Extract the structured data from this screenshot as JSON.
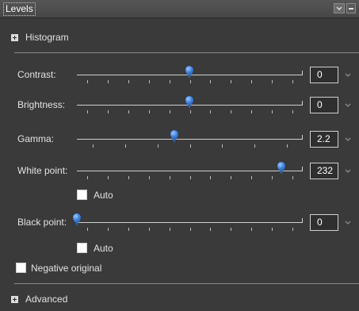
{
  "panel": {
    "title": "Levels",
    "dropdown_icon": "chevron-down-icon",
    "collapse_icon": "minus-icon"
  },
  "sections": {
    "histogram_label": "Histogram",
    "advanced_label": "Advanced",
    "expand_icon": "plus-box-icon"
  },
  "sliders": [
    {
      "key": "contrast",
      "label": "Contrast:",
      "value": "0",
      "thumb_fraction": 0.5
    },
    {
      "key": "brightness",
      "label": "Brightness:",
      "value": "0",
      "thumb_fraction": 0.5
    },
    {
      "key": "gamma",
      "label": "Gamma:",
      "value": "2.2",
      "thumb_fraction": 0.43
    },
    {
      "key": "white_point",
      "label": "White point:",
      "value": "232",
      "thumb_fraction": 0.91
    },
    {
      "key": "black_point",
      "label": "Black point:",
      "value": "0",
      "thumb_fraction": 0.0
    }
  ],
  "checkboxes": {
    "white_auto": {
      "label": "Auto",
      "checked": false
    },
    "black_auto": {
      "label": "Auto",
      "checked": false
    },
    "negative_original": {
      "label": "Negative original",
      "checked": false
    }
  },
  "colors": {
    "accent_thumb": "#3f7fd8",
    "panel_bg": "#3a3a3a"
  }
}
